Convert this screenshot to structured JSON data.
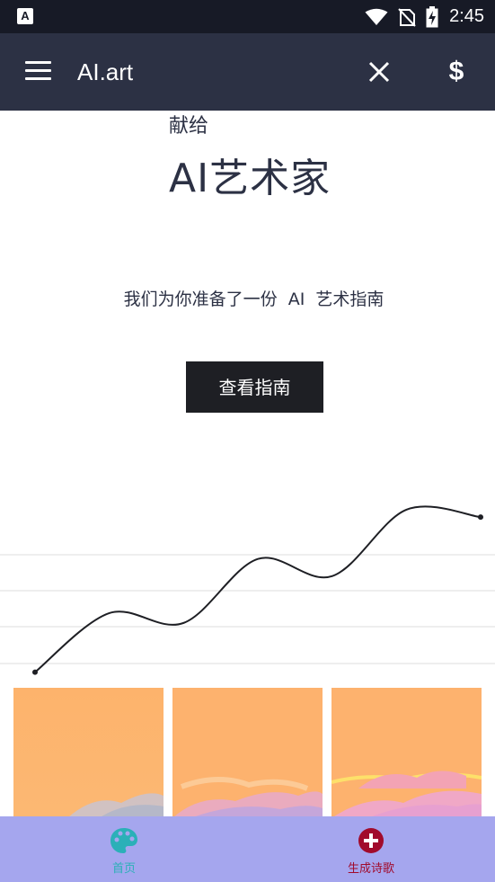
{
  "status_bar": {
    "app_badge": "A",
    "time": "2:45",
    "icons": [
      "wifi-icon",
      "no-sim-icon",
      "battery-charging-icon"
    ]
  },
  "app_bar": {
    "title": "AI.art",
    "icons": [
      "menu-icon",
      "close-icon",
      "dollar-icon"
    ],
    "dollar_symbol": "$"
  },
  "hero": {
    "dedication": "献给",
    "headline": "AI艺术家",
    "subtitle": "我们为你准备了一份 AI 艺术指南",
    "button_label": "查看指南"
  },
  "chart_data": {
    "type": "line",
    "values": [
      1,
      3.4,
      3.0,
      5.6,
      4.9,
      7.6,
      7.3
    ],
    "ylim": [
      0,
      8
    ],
    "grid": true
  },
  "artworks": [
    {
      "name": "sunset-clouds-art-1"
    },
    {
      "name": "sunset-clouds-art-2"
    },
    {
      "name": "sunset-clouds-art-3"
    }
  ],
  "bottom_nav": {
    "items": [
      {
        "label": "首页",
        "icon": "palette-icon"
      },
      {
        "label": "生成诗歌",
        "icon": "add-circle-icon"
      }
    ]
  },
  "colors": {
    "status_bar": "#171a26",
    "app_bar": "#2c3144",
    "text": "#2c3144",
    "button": "#1e1f24",
    "bottom_nav": "#a5a6ee",
    "nav_home": "#2bb0b8",
    "nav_generate": "#a10b2c"
  }
}
